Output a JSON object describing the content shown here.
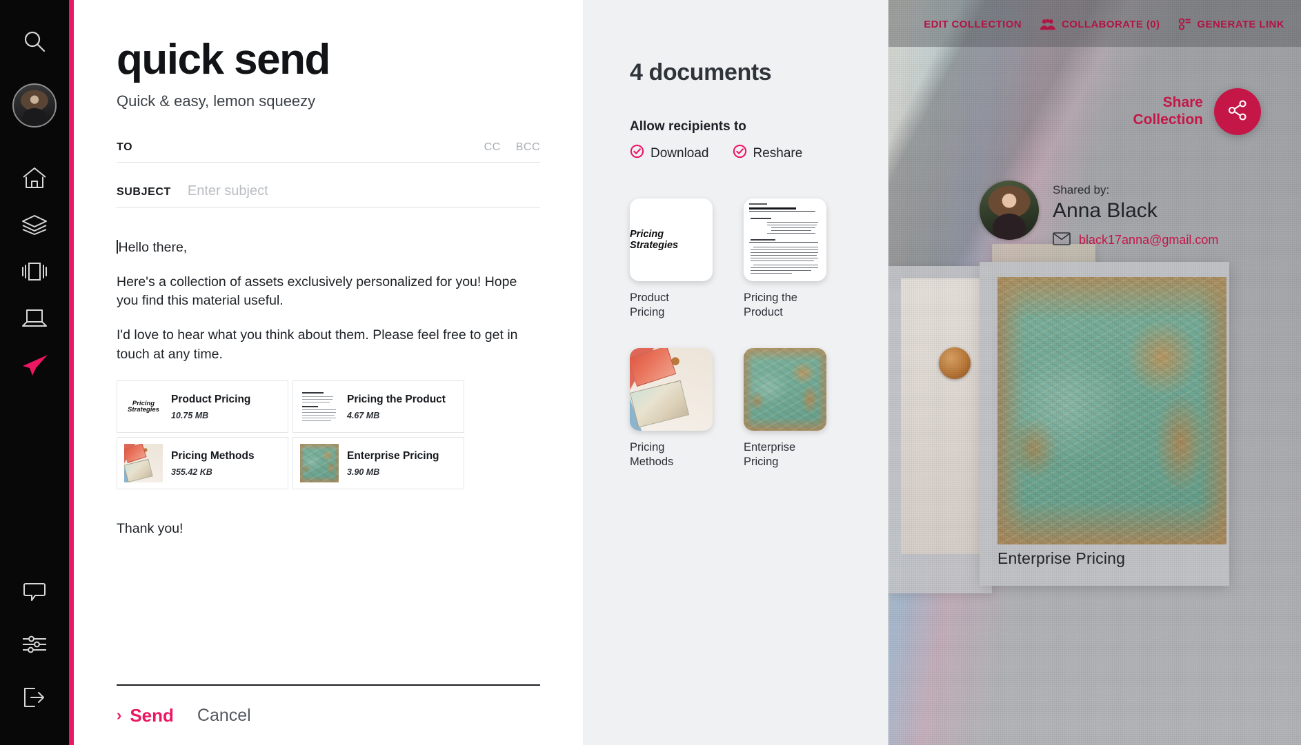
{
  "colors": {
    "accent_pink": "#ec1763",
    "accent_crimson": "#c41748",
    "toolbar_red": "#b01543",
    "panel_bg": "#f0f1f3",
    "rail_bg": "#080808"
  },
  "rail": {
    "items": [
      {
        "icon": "search-icon",
        "name": "search"
      },
      {
        "icon": "user-avatar",
        "name": "profile"
      },
      {
        "icon": "home-icon",
        "name": "home"
      },
      {
        "icon": "layers-icon",
        "name": "collections"
      },
      {
        "icon": "presentation-icon",
        "name": "presentations"
      },
      {
        "icon": "laptop-icon",
        "name": "devices"
      },
      {
        "icon": "send-plane-icon",
        "name": "quick-send"
      }
    ],
    "bottom_items": [
      {
        "icon": "chat-bubble-icon",
        "name": "messages"
      },
      {
        "icon": "sliders-icon",
        "name": "settings"
      },
      {
        "icon": "logout-icon",
        "name": "logout"
      }
    ]
  },
  "quick_send": {
    "title": "quick send",
    "subtitle": "Quick & easy, lemon squeezy",
    "to": {
      "label": "TO",
      "value": "",
      "placeholder": ""
    },
    "cc_label": "CC",
    "bcc_label": "BCC",
    "subject": {
      "label": "SUBJECT",
      "value": "",
      "placeholder": "Enter subject"
    },
    "body": [
      "Hello there,",
      "Here's a collection of assets exclusively personalized for you! Hope you find this material useful.",
      "I'd love to hear what you think about them. Please feel free to get in touch at any time."
    ],
    "closing": "Thank you!",
    "attachments": [
      {
        "name": "Product Pricing",
        "size": "10.75 MB",
        "thumb": "pricing-strategies-cover"
      },
      {
        "name": "Pricing the Product",
        "size": "4.67 MB",
        "thumb": "text-document-page"
      },
      {
        "name": "Pricing Methods",
        "size": "355.42 KB",
        "thumb": "euro-banknotes-coins-photo"
      },
      {
        "name": "Enterprise Pricing",
        "size": "3.90 MB",
        "thumb": "world-map-money-photo"
      }
    ],
    "send_label": "Send",
    "send_chevron": "›",
    "cancel_label": "Cancel"
  },
  "documents_panel": {
    "count_label": "4 documents",
    "allow_title": "Allow recipients to",
    "permissions": [
      {
        "label": "Download",
        "checked": true
      },
      {
        "label": "Reshare",
        "checked": true
      }
    ],
    "documents": [
      {
        "name": "Product Pricing",
        "thumb": "pricing-strategies-cover"
      },
      {
        "name": "Pricing the Product",
        "thumb": "text-document-page"
      },
      {
        "name": "Pricing Methods",
        "thumb": "euro-banknotes-coins-photo"
      },
      {
        "name": "Enterprise Pricing",
        "thumb": "world-map-money-photo"
      }
    ],
    "thumb_labels": {
      "pricing_strategies": "Pricing Strategies",
      "doc_title": "PRICING THE PRODUCT"
    }
  },
  "collection_toolbar": {
    "edit_label": "EDIT COLLECTION",
    "collaborate_label": "COLLABORATE (0)",
    "generate_link_label": "GENERATE LINK"
  },
  "share": {
    "label_line1": "Share",
    "label_line2": "Collection"
  },
  "shared_by": {
    "label": "Shared by:",
    "name": "Anna Black",
    "email": "black17anna@gmail.com"
  },
  "background_card": {
    "caption": "Enterprise Pricing"
  }
}
